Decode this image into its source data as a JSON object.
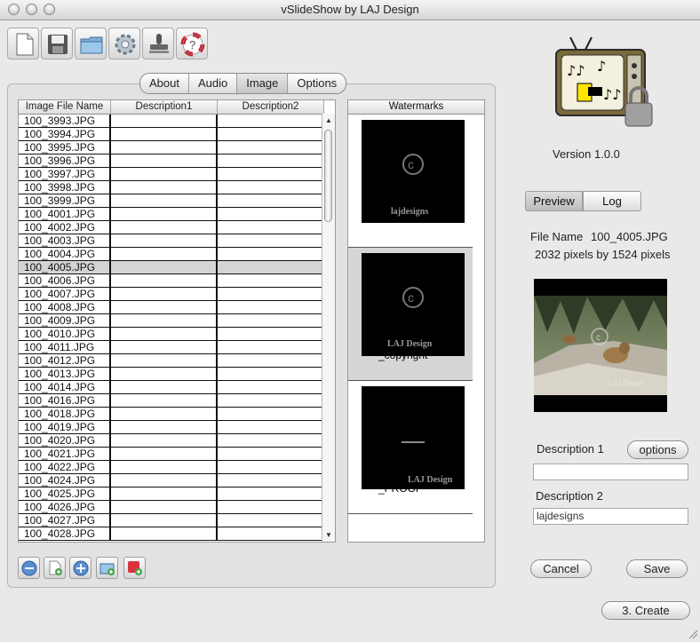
{
  "window": {
    "title": "vSlideShow by LAJ Design"
  },
  "toolbar": {
    "icons": [
      "new-document-icon",
      "save-disk-icon",
      "open-folder-icon",
      "settings-gear-icon",
      "stamp-icon",
      "help-lifebuoy-icon"
    ]
  },
  "tabs": [
    "About",
    "Audio",
    "Image",
    "Options"
  ],
  "active_tab": "Image",
  "table": {
    "columns": [
      "Image File Name",
      "Description1",
      "Description2"
    ],
    "rows": [
      "100_3993.JPG",
      "100_3994.JPG",
      "100_3995.JPG",
      "100_3996.JPG",
      "100_3997.JPG",
      "100_3998.JPG",
      "100_3999.JPG",
      "100_4001.JPG",
      "100_4002.JPG",
      "100_4003.JPG",
      "100_4004.JPG",
      "100_4005.JPG",
      "100_4006.JPG",
      "100_4007.JPG",
      "100_4008.JPG",
      "100_4009.JPG",
      "100_4010.JPG",
      "100_4011.JPG",
      "100_4012.JPG",
      "100_4013.JPG",
      "100_4014.JPG",
      "100_4016.JPG",
      "100_4018.JPG",
      "100_4019.JPG",
      "100_4020.JPG",
      "100_4021.JPG",
      "100_4022.JPG",
      "100_4024.JPG",
      "100_4025.JPG",
      "100_4026.JPG",
      "100_4027.JPG",
      "100_4028.JPG"
    ],
    "selected_row": "100_4005.JPG"
  },
  "watermarks": {
    "header": "Watermarks",
    "items": [
      {
        "image_text": "lajdesigns",
        "label": ""
      },
      {
        "image_text": "LAJ Design",
        "label": "_copyright"
      },
      {
        "image_text": "LAJ Design",
        "label": "_PROOF"
      }
    ],
    "selected_index": 1
  },
  "bottom_buttons": [
    "remove-icon",
    "add-file-icon",
    "add-icon",
    "add-folder-icon",
    "delete-red-icon"
  ],
  "app": {
    "version": "Version 1.0.0"
  },
  "preview_tabs": [
    "Preview",
    "Log"
  ],
  "file_info": {
    "file_name_label": "File Name",
    "file_name": "100_4005.JPG",
    "dimensions": "2032 pixels by 1524 pixels",
    "preview_watermark": "LAJ Design"
  },
  "desc1": {
    "label": "Description 1",
    "options_button": "options",
    "value": ""
  },
  "desc2": {
    "label": "Description 2",
    "value": "lajdesigns"
  },
  "buttons": {
    "cancel": "Cancel",
    "save": "Save",
    "create": "3. Create"
  }
}
